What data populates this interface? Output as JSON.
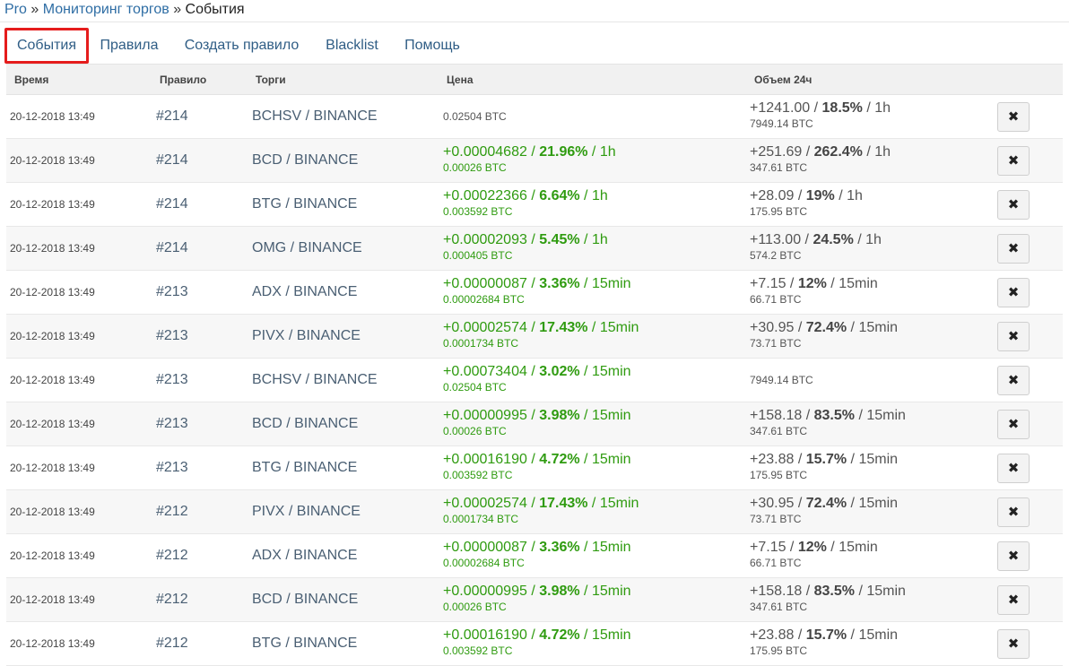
{
  "breadcrumb": {
    "items": [
      "Pro",
      "Мониторинг торгов",
      "События"
    ],
    "separator": "»"
  },
  "tabs": [
    {
      "label": "События",
      "active": true
    },
    {
      "label": "Правила",
      "active": false
    },
    {
      "label": "Создать правило",
      "active": false
    },
    {
      "label": "Blacklist",
      "active": false
    },
    {
      "label": "Помощь",
      "active": false
    }
  ],
  "table": {
    "headers": {
      "time": "Время",
      "rule": "Правило",
      "pair": "Торги",
      "price": "Цена",
      "volume": "Объем 24ч"
    },
    "rows": [
      {
        "time": "20-12-2018 13:49",
        "rule": "#214",
        "pair": "BCHSV / BINANCE",
        "price": {
          "change": "",
          "pct": "",
          "period": "",
          "value": "0.02504 BTC"
        },
        "volume": {
          "change": "+1241.00",
          "pct": "18.5%",
          "period": "1h",
          "value": "7949.14 BTC"
        }
      },
      {
        "time": "20-12-2018 13:49",
        "rule": "#214",
        "pair": "BCD / BINANCE",
        "price": {
          "change": "+0.00004682",
          "pct": "21.96%",
          "period": "1h",
          "value": "0.00026 BTC"
        },
        "volume": {
          "change": "+251.69",
          "pct": "262.4%",
          "period": "1h",
          "value": "347.61 BTC"
        }
      },
      {
        "time": "20-12-2018 13:49",
        "rule": "#214",
        "pair": "BTG / BINANCE",
        "price": {
          "change": "+0.00022366",
          "pct": "6.64%",
          "period": "1h",
          "value": "0.003592 BTC"
        },
        "volume": {
          "change": "+28.09",
          "pct": "19%",
          "period": "1h",
          "value": "175.95 BTC"
        }
      },
      {
        "time": "20-12-2018 13:49",
        "rule": "#214",
        "pair": "OMG / BINANCE",
        "price": {
          "change": "+0.00002093",
          "pct": "5.45%",
          "period": "1h",
          "value": "0.000405 BTC"
        },
        "volume": {
          "change": "+113.00",
          "pct": "24.5%",
          "period": "1h",
          "value": "574.2 BTC"
        }
      },
      {
        "time": "20-12-2018 13:49",
        "rule": "#213",
        "pair": "ADX / BINANCE",
        "price": {
          "change": "+0.00000087",
          "pct": "3.36%",
          "period": "15min",
          "value": "0.00002684 BTC"
        },
        "volume": {
          "change": "+7.15",
          "pct": "12%",
          "period": "15min",
          "value": "66.71 BTC"
        }
      },
      {
        "time": "20-12-2018 13:49",
        "rule": "#213",
        "pair": "PIVX / BINANCE",
        "price": {
          "change": "+0.00002574",
          "pct": "17.43%",
          "period": "15min",
          "value": "0.0001734 BTC"
        },
        "volume": {
          "change": "+30.95",
          "pct": "72.4%",
          "period": "15min",
          "value": "73.71 BTC"
        }
      },
      {
        "time": "20-12-2018 13:49",
        "rule": "#213",
        "pair": "BCHSV / BINANCE",
        "price": {
          "change": "+0.00073404",
          "pct": "3.02%",
          "period": "15min",
          "value": "0.02504 BTC"
        },
        "volume": {
          "change": "",
          "pct": "",
          "period": "",
          "value": "7949.14 BTC"
        }
      },
      {
        "time": "20-12-2018 13:49",
        "rule": "#213",
        "pair": "BCD / BINANCE",
        "price": {
          "change": "+0.00000995",
          "pct": "3.98%",
          "period": "15min",
          "value": "0.00026 BTC"
        },
        "volume": {
          "change": "+158.18",
          "pct": "83.5%",
          "period": "15min",
          "value": "347.61 BTC"
        }
      },
      {
        "time": "20-12-2018 13:49",
        "rule": "#213",
        "pair": "BTG / BINANCE",
        "price": {
          "change": "+0.00016190",
          "pct": "4.72%",
          "period": "15min",
          "value": "0.003592 BTC"
        },
        "volume": {
          "change": "+23.88",
          "pct": "15.7%",
          "period": "15min",
          "value": "175.95 BTC"
        }
      },
      {
        "time": "20-12-2018 13:49",
        "rule": "#212",
        "pair": "PIVX / BINANCE",
        "price": {
          "change": "+0.00002574",
          "pct": "17.43%",
          "period": "15min",
          "value": "0.0001734 BTC"
        },
        "volume": {
          "change": "+30.95",
          "pct": "72.4%",
          "period": "15min",
          "value": "73.71 BTC"
        }
      },
      {
        "time": "20-12-2018 13:49",
        "rule": "#212",
        "pair": "ADX / BINANCE",
        "price": {
          "change": "+0.00000087",
          "pct": "3.36%",
          "period": "15min",
          "value": "0.00002684 BTC"
        },
        "volume": {
          "change": "+7.15",
          "pct": "12%",
          "period": "15min",
          "value": "66.71 BTC"
        }
      },
      {
        "time": "20-12-2018 13:49",
        "rule": "#212",
        "pair": "BCD / BINANCE",
        "price": {
          "change": "+0.00000995",
          "pct": "3.98%",
          "period": "15min",
          "value": "0.00026 BTC"
        },
        "volume": {
          "change": "+158.18",
          "pct": "83.5%",
          "period": "15min",
          "value": "347.61 BTC"
        }
      },
      {
        "time": "20-12-2018 13:49",
        "rule": "#212",
        "pair": "BTG / BINANCE",
        "price": {
          "change": "+0.00016190",
          "pct": "4.72%",
          "period": "15min",
          "value": "0.003592 BTC"
        },
        "volume": {
          "change": "+23.88",
          "pct": "15.7%",
          "period": "15min",
          "value": "175.95 BTC"
        }
      }
    ],
    "delete_icon": "close-icon",
    "delete_glyph": "✖"
  },
  "colors": {
    "link": "#2e6da4",
    "positive": "#2f9b10",
    "active_tab_border": "#e51c1c"
  }
}
